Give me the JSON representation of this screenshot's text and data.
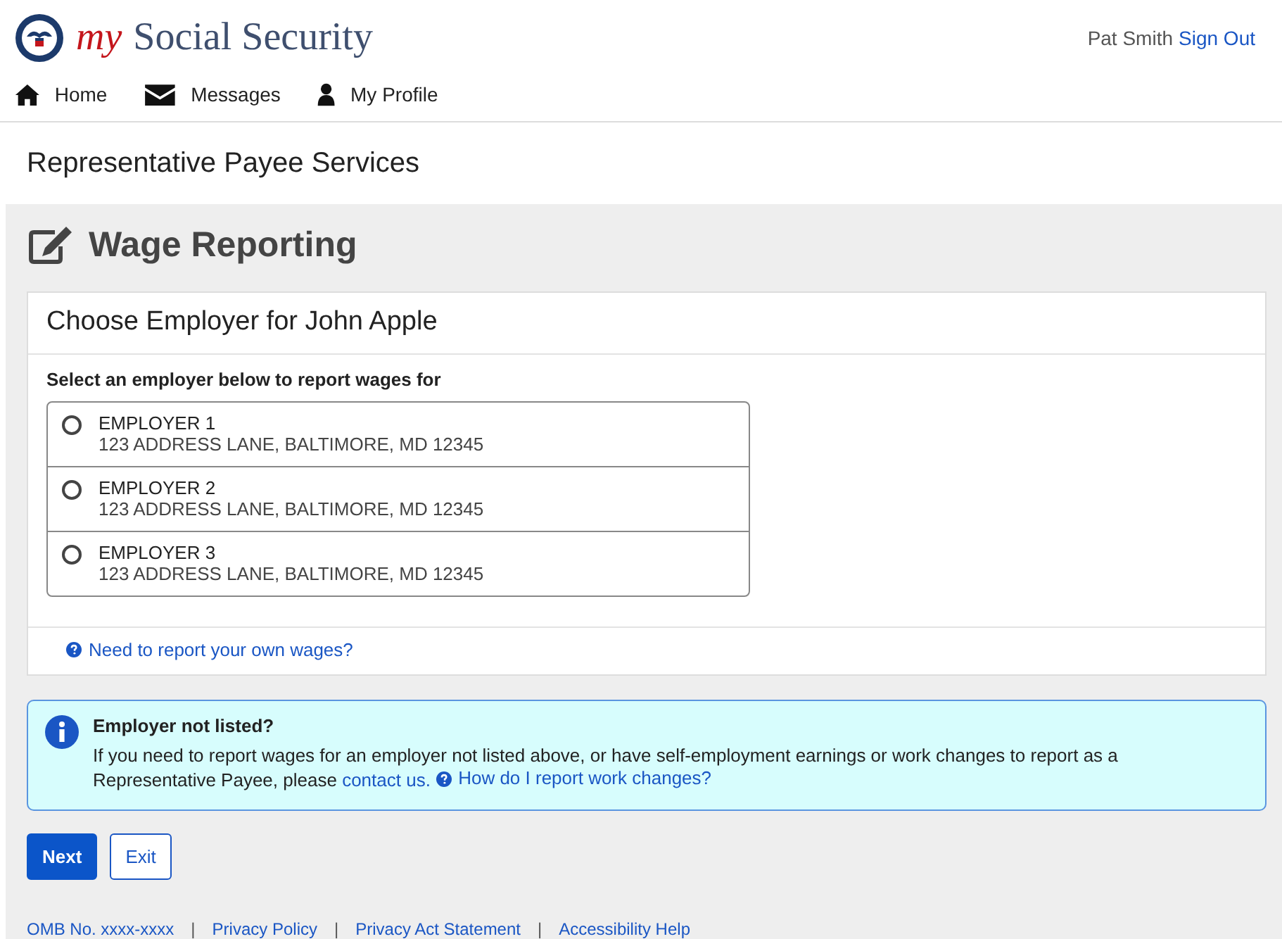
{
  "header": {
    "logo_prefix": "my",
    "logo_text": "Social Security",
    "user_name": "Pat Smith",
    "sign_out": "Sign Out"
  },
  "nav": [
    {
      "label": "Home",
      "kind": "home"
    },
    {
      "label": "Messages",
      "kind": "mail"
    },
    {
      "label": "My Profile",
      "kind": "user"
    }
  ],
  "section_title": "Representative Payee Services",
  "page_title": "Wage Reporting",
  "card": {
    "title": "Choose Employer for John Apple",
    "prompt": "Select an employer below to report wages for",
    "employers": [
      {
        "name": "EMPLOYER 1",
        "address": "123 ADDRESS LANE, BALTIMORE, MD 12345",
        "selected": false
      },
      {
        "name": "EMPLOYER 2",
        "address": "123 ADDRESS LANE, BALTIMORE, MD 12345",
        "selected": false
      },
      {
        "name": "EMPLOYER 3",
        "address": "123 ADDRESS LANE, BALTIMORE, MD 12345",
        "selected": false
      }
    ],
    "help_link": "Need to report your own wages?"
  },
  "info": {
    "title": "Employer not listed?",
    "text": "If you need to report wages for an employer not listed above, or have self-employment earnings or work changes to report as a Representative Payee, please",
    "contact_link": "contact us.",
    "help_link": "How do I report work changes?"
  },
  "buttons": [
    {
      "label": "Next",
      "kind": "primary"
    },
    {
      "label": "Exit",
      "kind": "secondary"
    }
  ],
  "footer": {
    "separator": "|",
    "links": [
      "OMB No. xxxx-xxxx",
      "Privacy Policy",
      "Privacy Act Statement",
      "Accessibility Help"
    ]
  }
}
